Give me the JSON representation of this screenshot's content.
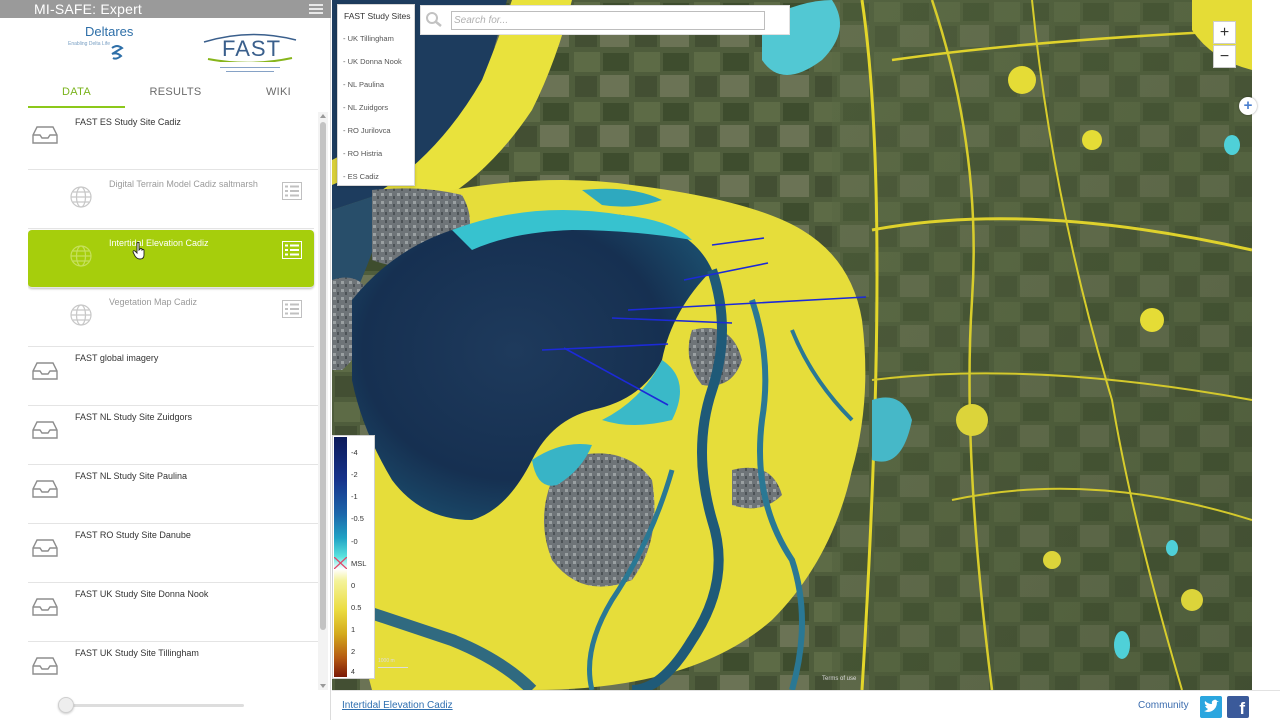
{
  "app": {
    "title": "MI-SAFE: Expert"
  },
  "logos": {
    "deltares": {
      "name": "Deltares",
      "tagline": "Enabling Delta Life"
    },
    "fast": {
      "name": "FAST"
    }
  },
  "tabs": [
    {
      "label": "DATA",
      "active": true
    },
    {
      "label": "RESULTS",
      "active": false
    },
    {
      "label": "WIKI",
      "active": false
    }
  ],
  "layers": [
    {
      "kind": "group",
      "label": "FAST ES Study Site Cadiz",
      "icon": "tray-icon"
    },
    {
      "kind": "layer",
      "label": "Digital Terrain Model Cadiz saltmarsh",
      "icon": "globe-icon",
      "selected": false
    },
    {
      "kind": "layer",
      "label": "Intertidal Elevation Cadiz",
      "icon": "globe-icon",
      "selected": true
    },
    {
      "kind": "layer",
      "label": "Vegetation Map Cadiz",
      "icon": "globe-icon",
      "selected": false
    },
    {
      "kind": "group",
      "label": "FAST global imagery",
      "icon": "tray-icon"
    },
    {
      "kind": "group",
      "label": "FAST NL Study Site Zuidgors",
      "icon": "tray-icon"
    },
    {
      "kind": "group",
      "label": "FAST NL Study Site Paulina",
      "icon": "tray-icon"
    },
    {
      "kind": "group",
      "label": "FAST RO Study Site Danube",
      "icon": "tray-icon"
    },
    {
      "kind": "group",
      "label": "FAST UK Study Site Donna Nook",
      "icon": "tray-icon"
    },
    {
      "kind": "group",
      "label": "FAST UK Study Site Tillingham",
      "icon": "tray-icon"
    }
  ],
  "study_sites": {
    "header": "FAST Study Sites",
    "items": [
      "- UK Tillingham",
      "- UK Donna Nook",
      "- NL Paulina",
      "- NL Zuidgors",
      "- RO Jurilovca",
      "- RO Histria",
      "- ES Cadiz"
    ]
  },
  "search": {
    "placeholder": "Search for..."
  },
  "zoom": {
    "in": "+",
    "out": "−"
  },
  "add_button": "+",
  "legend": {
    "ticks": [
      "-4",
      "-2",
      "-1",
      "-0.5",
      "-0",
      "MSL",
      "0",
      "0.5",
      "1",
      "2",
      "4"
    ],
    "colors": [
      "#0c1a5a",
      "#16308a",
      "#1d5aa6",
      "#1c8cbc",
      "#22c4d2",
      "#5de6e0",
      "#f2f29a",
      "#ece04a",
      "#d8b81e",
      "#bb6e14",
      "#8a2208"
    ]
  },
  "scale_bar": {
    "label": "1000 m"
  },
  "attribution": "Terms of use",
  "footer": {
    "active_layer": "Intertidal Elevation Cadiz",
    "community": "Community",
    "facebook": "f"
  },
  "colors": {
    "accent": "#8cc81a",
    "selected_row": "#a6ce0c",
    "link": "#2f6fb0",
    "water": "#1a3050",
    "intertidal_high": "#e9e23c",
    "intertidal_low": "#2fb4c6"
  }
}
